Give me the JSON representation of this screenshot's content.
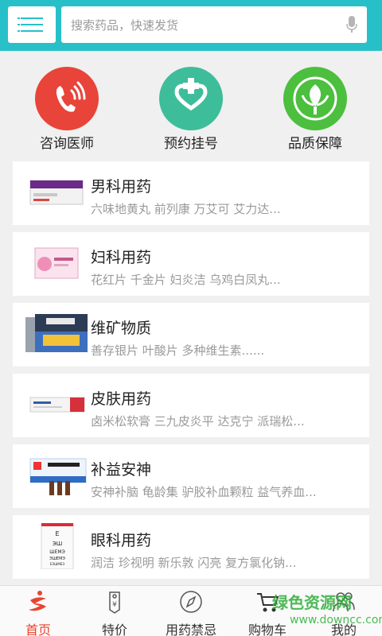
{
  "header": {
    "search_placeholder": "搜索药品，快速发货"
  },
  "quick_actions": [
    {
      "label": "咨询医师",
      "icon": "phone-icon",
      "color": "#e8443a"
    },
    {
      "label": "预约挂号",
      "icon": "medical-cross-heart-icon",
      "color": "#3ebd9a"
    },
    {
      "label": "品质保障",
      "icon": "quality-emblem-icon",
      "color": "#4cbf3e"
    }
  ],
  "categories": [
    {
      "title": "男科用药",
      "subtitle": "六味地黄丸 前列康 万艾可 艾力达..."
    },
    {
      "title": "妇科用药",
      "subtitle": "花红片 千金片 妇炎洁 乌鸡白凤丸..."
    },
    {
      "title": "维矿物质",
      "subtitle": "善存银片 叶酸片 多种维生素......"
    },
    {
      "title": "皮肤用药",
      "subtitle": "卤米松软膏 三九皮炎平 达克宁 派瑞松..."
    },
    {
      "title": "补益安神",
      "subtitle": "安神补脑 龟龄集 驴胶补血颗粒 益气养血..."
    },
    {
      "title": "眼科用药",
      "subtitle": "润洁 珍视明 新乐敦 闪亮 复方氯化钠..."
    }
  ],
  "tabbar": [
    {
      "label": "首页",
      "active": true
    },
    {
      "label": "特价",
      "active": false
    },
    {
      "label": "用药禁忌",
      "active": false
    },
    {
      "label": "购物车",
      "active": false
    },
    {
      "label": "我的",
      "active": false
    }
  ],
  "watermark": {
    "title": "绿色资源网",
    "url": "www.downcc.com"
  },
  "colors": {
    "header": "#27c0c9",
    "active_tab": "#e8452f"
  }
}
